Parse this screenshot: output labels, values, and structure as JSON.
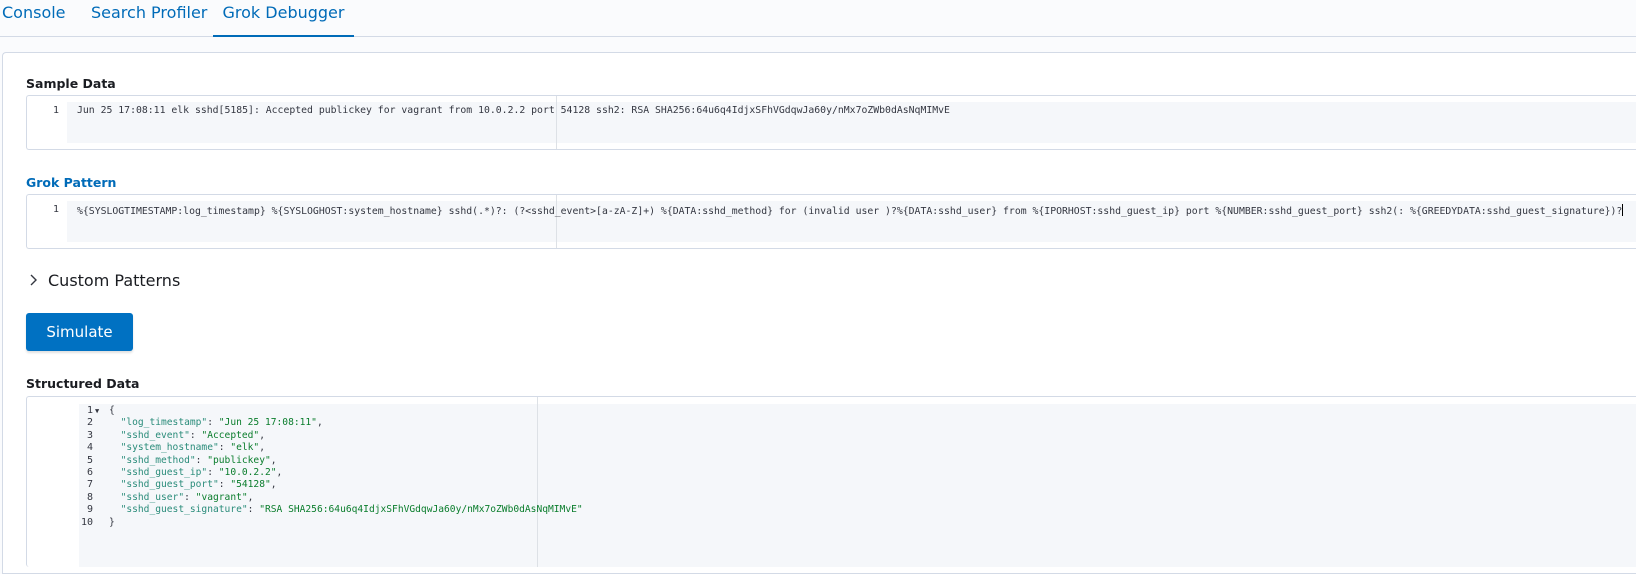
{
  "tabs": [
    {
      "label": "Console",
      "active": false
    },
    {
      "label": "Search Profiler",
      "active": false
    },
    {
      "label": "Grok Debugger",
      "active": true
    }
  ],
  "sample_data": {
    "label": "Sample Data",
    "line_number": "1",
    "text": "Jun 25 17:08:11 elk sshd[5185]: Accepted publickey for vagrant from 10.0.2.2 port 54128 ssh2: RSA SHA256:64u6q4IdjxSFhVGdqwJa60y/nMx7oZWb0dAsNqMIMvE"
  },
  "grok_pattern": {
    "label": "Grok Pattern",
    "line_number": "1",
    "text": "%{SYSLOGTIMESTAMP:log_timestamp} %{SYSLOGHOST:system_hostname} sshd(.*)?: (?<sshd_event>[a-zA-Z]+) %{DATA:sshd_method} for (invalid user )?%{DATA:sshd_user} from %{IPORHOST:sshd_guest_ip} port %{NUMBER:sshd_guest_port} ssh2(: %{GREEDYDATA:sshd_guest_signature})?"
  },
  "custom_patterns": {
    "label": "Custom Patterns",
    "icon": "chevron-right-icon"
  },
  "simulate_button": {
    "label": "Simulate",
    "color": "#0071c2"
  },
  "structured_data": {
    "label": "Structured Data",
    "line_numbers": [
      "1",
      "2",
      "3",
      "4",
      "5",
      "6",
      "7",
      "8",
      "9",
      "10"
    ],
    "open_brace": "{",
    "close_brace": "}",
    "fields": [
      {
        "key": "\"log_timestamp\"",
        "value": "\"Jun 25 17:08:11\"",
        "sep": ": ",
        "end": ","
      },
      {
        "key": "\"sshd_event\"",
        "value": "\"Accepted\"",
        "sep": ": ",
        "end": ","
      },
      {
        "key": "\"system_hostname\"",
        "value": "\"elk\"",
        "sep": ": ",
        "end": ","
      },
      {
        "key": "\"sshd_method\"",
        "value": "\"publickey\"",
        "sep": ": ",
        "end": ","
      },
      {
        "key": "\"sshd_guest_ip\"",
        "value": "\"10.0.2.2\"",
        "sep": ": ",
        "end": ","
      },
      {
        "key": "\"sshd_guest_port\"",
        "value": "\"54128\"",
        "sep": ": ",
        "end": ","
      },
      {
        "key": "\"sshd_user\"",
        "value": "\"vagrant\"",
        "sep": ": ",
        "end": ","
      },
      {
        "key": "\"sshd_guest_signature\"",
        "value": "\"RSA SHA256:64u6q4IdjxSFhVGdqwJa60y/nMx7oZWb0dAsNqMIMvE\"",
        "sep": ": ",
        "end": ""
      }
    ]
  },
  "colors": {
    "accent": "#006bb8",
    "json_key": "#2a8c7a",
    "json_string": "#0a7d2c"
  }
}
